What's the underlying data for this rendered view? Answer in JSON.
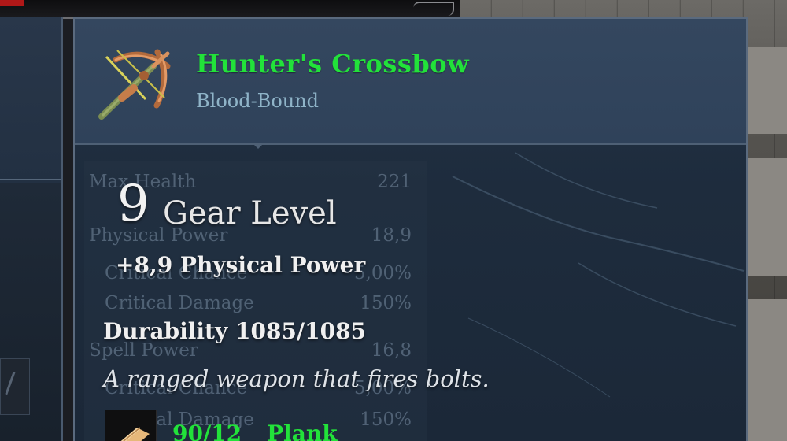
{
  "item": {
    "name": "Hunter's Crossbow",
    "subtitle": "Blood-Bound",
    "icon": "crossbow-icon",
    "name_color": "#22e23a"
  },
  "gear_level": {
    "value": "9",
    "label": "Gear Level"
  },
  "stat_bonus": "+8,9 Physical Power",
  "durability": {
    "label": "Durability",
    "value": "1085/1085"
  },
  "description": "A ranged weapon that fires bolts.",
  "material": {
    "count": "90/12",
    "name": "Plank",
    "icon": "plank-icon"
  },
  "background_stats": [
    {
      "label": "Max Health",
      "value": "221"
    },
    {
      "label": "Physical Power",
      "value": "18,9"
    },
    {
      "label": "Critical Chance",
      "value": "5,00%"
    },
    {
      "label": "Critical Damage",
      "value": "150%"
    },
    {
      "label": "Spell Power",
      "value": "16,8"
    },
    {
      "label": "Critical Chance",
      "value": "5,00%"
    },
    {
      "label": "Critical Damage",
      "value": "150%"
    }
  ]
}
